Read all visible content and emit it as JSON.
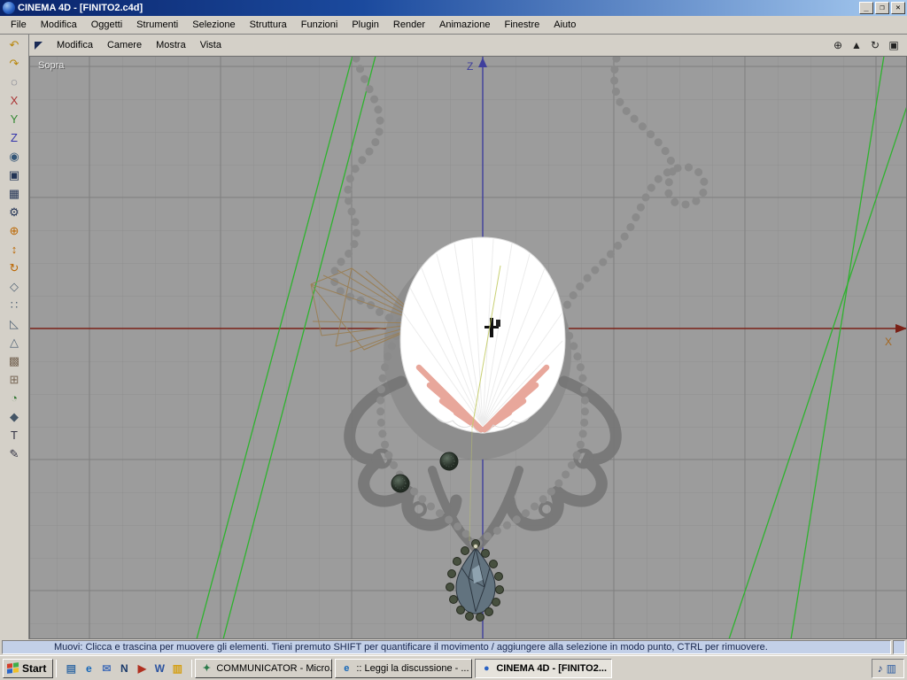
{
  "window": {
    "title": "CINEMA 4D - [FINITO2.c4d]",
    "controls": {
      "minimize": "_",
      "restore": "❐",
      "close": "✕"
    }
  },
  "menu_bar": {
    "items": [
      "File",
      "Modifica",
      "Oggetti",
      "Strumenti",
      "Selezione",
      "Struttura",
      "Funzioni",
      "Plugin",
      "Render",
      "Animazione",
      "Finestre",
      "Aiuto"
    ]
  },
  "viewport_toolbar": {
    "items": [
      "Modifica",
      "Camere",
      "Mostra",
      "Vista"
    ],
    "view_controls": [
      {
        "name": "pan-view-icon",
        "glyph": "⊕"
      },
      {
        "name": "zoom-view-icon",
        "glyph": "▲"
      },
      {
        "name": "rotate-view-icon",
        "glyph": "↻"
      },
      {
        "name": "toggle-layout-icon",
        "glyph": "▣"
      }
    ]
  },
  "left_toolbar": {
    "icons": [
      {
        "name": "undo-icon",
        "glyph": "↶",
        "color": "#b8860b"
      },
      {
        "name": "redo-icon",
        "glyph": "↷",
        "color": "#b8860b"
      },
      {
        "name": "live-selection-icon",
        "glyph": "◌",
        "color": "#444a66"
      },
      {
        "name": "lock-x-axis-icon",
        "glyph": "X",
        "color": "#aa3333"
      },
      {
        "name": "lock-y-axis-icon",
        "glyph": "Y",
        "color": "#338833"
      },
      {
        "name": "lock-z-axis-icon",
        "glyph": "Z",
        "color": "#3333aa"
      },
      {
        "name": "coordinate-system-icon",
        "glyph": "◉",
        "color": "#335577"
      },
      {
        "name": "render-view-icon",
        "glyph": "▣",
        "color": "#223355"
      },
      {
        "name": "render-picture-viewer-icon",
        "glyph": "▦",
        "color": "#223355"
      },
      {
        "name": "render-settings-icon",
        "glyph": "⚙",
        "color": "#223355"
      },
      {
        "name": "move-tool-icon",
        "glyph": "⊕",
        "color": "#bb6600"
      },
      {
        "name": "scale-tool-icon",
        "glyph": "↕",
        "color": "#bb6600"
      },
      {
        "name": "rotate-tool-icon",
        "glyph": "↻",
        "color": "#bb6600"
      },
      {
        "name": "object-mode-icon",
        "glyph": "◇",
        "color": "#556677"
      },
      {
        "name": "points-mode-icon",
        "glyph": "∷",
        "color": "#556677"
      },
      {
        "name": "edges-mode-icon",
        "glyph": "◺",
        "color": "#556677"
      },
      {
        "name": "polygons-mode-icon",
        "glyph": "△",
        "color": "#556677"
      },
      {
        "name": "texture-mode-icon",
        "glyph": "▩",
        "color": "#776655"
      },
      {
        "name": "texture-axis-mode-icon",
        "glyph": "⊞",
        "color": "#776655"
      },
      {
        "name": "animation-mode-icon",
        "glyph": "◔",
        "color": "#337733"
      },
      {
        "name": "model-mode-icon",
        "glyph": "◆",
        "color": "#445566"
      },
      {
        "name": "text-tool-icon",
        "glyph": "T",
        "color": "#333344"
      },
      {
        "name": "pen-tool-icon",
        "glyph": "✎",
        "color": "#333344"
      }
    ]
  },
  "viewport": {
    "label": "Sopra",
    "axis_labels": {
      "vertical": "Z",
      "horizontal": "X"
    },
    "colors": {
      "background": "#9c9c9c",
      "grid_minor": "#8f8f8f",
      "grid_major": "#7e7e7e",
      "x_axis": "#7a2016",
      "z_axis": "#3f3f9d",
      "construction_line": "#2eb32e"
    }
  },
  "status_bar": {
    "text": "Muovi: Clicca e trascina per muovere gli elementi. Tieni premuto SHIFT per quantificare il movimento / aggiungere alla selezione in modo punto, CTRL per rimuovere."
  },
  "taskbar": {
    "start": "Start",
    "quick_launch": [
      {
        "name": "show-desktop-icon",
        "glyph": "▤",
        "color": "#3a6ea5"
      },
      {
        "name": "internet-explorer-icon",
        "glyph": "e",
        "color": "#1466b8"
      },
      {
        "name": "outlook-icon",
        "glyph": "✉",
        "color": "#4a72b8"
      },
      {
        "name": "netscape-icon",
        "glyph": "N",
        "color": "#1a3a6a"
      },
      {
        "name": "media-player-icon",
        "glyph": "▶",
        "color": "#b03020"
      },
      {
        "name": "word-icon",
        "glyph": "W",
        "color": "#2a52a0"
      },
      {
        "name": "explorer-icon",
        "glyph": "▥",
        "color": "#d4a017"
      }
    ],
    "tasks": [
      {
        "name": "task-communicator",
        "label": "COMMUNICATOR - Micro...",
        "glyph": "✦",
        "color": "#2a7a4a",
        "active": false
      },
      {
        "name": "task-browser",
        "label": ":: Leggi la discussione - ...",
        "glyph": "e",
        "color": "#1466b8",
        "active": false
      },
      {
        "name": "task-cinema4d",
        "label": "CINEMA 4D - [FINITO2...",
        "glyph": "●",
        "color": "#2a62c4",
        "active": true
      }
    ],
    "tray": [
      {
        "name": "volume-tray-icon",
        "glyph": "♪",
        "color": "#1a3a7a"
      },
      {
        "name": "display-tray-icon",
        "glyph": "▥",
        "color": "#2a5aa0"
      }
    ]
  }
}
